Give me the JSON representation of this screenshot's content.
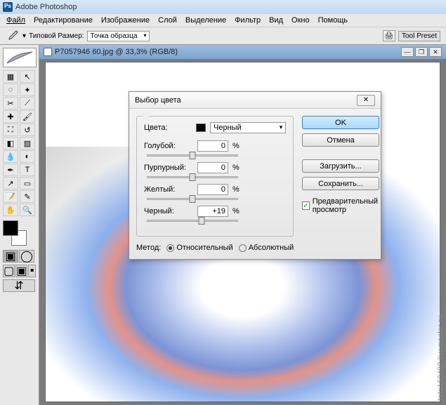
{
  "app": {
    "title": "Adobe Photoshop"
  },
  "menu": {
    "file": "Файл",
    "edit": "Редактирование",
    "image": "Изображение",
    "layer": "Слой",
    "select": "Выделение",
    "filter": "Фильтр",
    "view": "Вид",
    "window": "Окно",
    "help": "Помощь"
  },
  "options": {
    "size_label": "Типовой Размер:",
    "sample_mode": "Точка образца",
    "tool_preset": "Tool Preset"
  },
  "document": {
    "title": "P7057946 60.jpg @ 33,3% (RGB/8)"
  },
  "dialog": {
    "title": "Выбор цвета",
    "colors_label": "Цвета:",
    "color_name": "Черный",
    "cyan_label": "Голубой:",
    "cyan_value": "0",
    "magenta_label": "Пурпурный:",
    "magenta_value": "0",
    "yellow_label": "Желтый:",
    "yellow_value": "0",
    "black_label": "Черный:",
    "black_value": "+19",
    "pct": "%",
    "method_label": "Метод:",
    "method_relative": "Относительный",
    "method_absolute": "Абсолютный",
    "btn_ok": "OK",
    "btn_cancel": "Отмена",
    "btn_load": "Загрузить...",
    "btn_save": "Сохранить...",
    "preview_label": "Предварительный просмотр"
  },
  "watermark": "tata160400.livemaster.ru"
}
